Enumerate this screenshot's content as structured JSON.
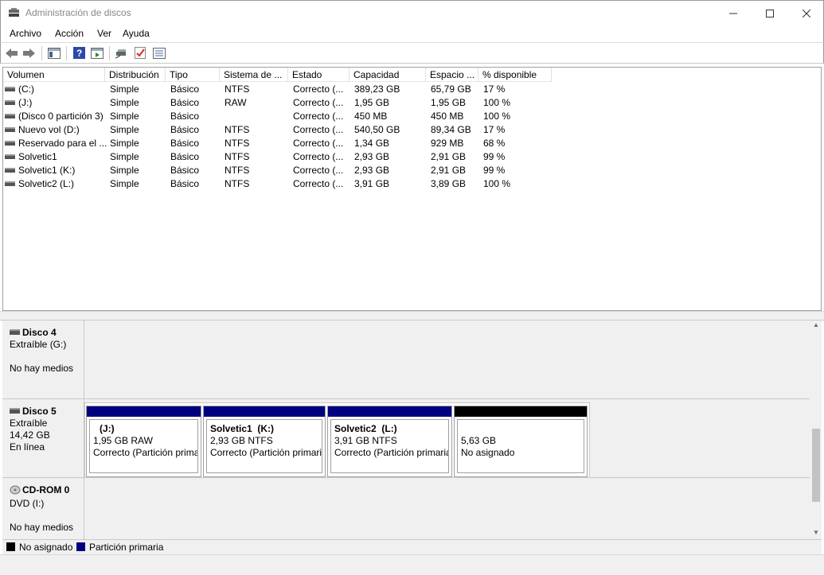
{
  "window": {
    "title": "Administración de discos"
  },
  "menu": [
    "Archivo",
    "Acción",
    "Ver",
    "Ayuda"
  ],
  "columns": [
    "Volumen",
    "Distribución",
    "Tipo",
    "Sistema de ...",
    "Estado",
    "Capacidad",
    "Espacio ...",
    "% disponible"
  ],
  "volumes": [
    {
      "name": "(C:)",
      "layout": "Simple",
      "type": "Básico",
      "fs": "NTFS",
      "status": "Correcto (...",
      "capacity": "389,23 GB",
      "free": "65,79 GB",
      "pct": "17 %"
    },
    {
      "name": "(J:)",
      "layout": "Simple",
      "type": "Básico",
      "fs": "RAW",
      "status": "Correcto (...",
      "capacity": "1,95 GB",
      "free": "1,95 GB",
      "pct": "100 %"
    },
    {
      "name": "(Disco 0 partición 3)",
      "layout": "Simple",
      "type": "Básico",
      "fs": "",
      "status": "Correcto (...",
      "capacity": "450 MB",
      "free": "450 MB",
      "pct": "100 %"
    },
    {
      "name": "Nuevo vol (D:)",
      "layout": "Simple",
      "type": "Básico",
      "fs": "NTFS",
      "status": "Correcto (...",
      "capacity": "540,50 GB",
      "free": "89,34 GB",
      "pct": "17 %"
    },
    {
      "name": "Reservado para el ...",
      "layout": "Simple",
      "type": "Básico",
      "fs": "NTFS",
      "status": "Correcto (...",
      "capacity": "1,34 GB",
      "free": "929 MB",
      "pct": "68 %"
    },
    {
      "name": "Solvetic1",
      "layout": "Simple",
      "type": "Básico",
      "fs": "NTFS",
      "status": "Correcto (...",
      "capacity": "2,93 GB",
      "free": "2,91 GB",
      "pct": "99 %"
    },
    {
      "name": "Solvetic1 (K:)",
      "layout": "Simple",
      "type": "Básico",
      "fs": "NTFS",
      "status": "Correcto (...",
      "capacity": "2,93 GB",
      "free": "2,91 GB",
      "pct": "99 %"
    },
    {
      "name": "Solvetic2 (L:)",
      "layout": "Simple",
      "type": "Básico",
      "fs": "NTFS",
      "status": "Correcto (...",
      "capacity": "3,91 GB",
      "free": "3,89 GB",
      "pct": "100 %"
    }
  ],
  "disks": [
    {
      "name": "Disco 4",
      "line2": "Extraíble (G:)",
      "line3": "",
      "line4": "No hay medios"
    },
    {
      "name": "Disco 5",
      "line2": "Extraíble",
      "line3": "14,42 GB",
      "line4": "En línea"
    },
    {
      "name": "CD-ROM 0",
      "line2": "DVD (I:)",
      "line3": "",
      "line4": "No hay medios"
    }
  ],
  "partitions": [
    {
      "name": "(J:)",
      "size": "1,95 GB RAW",
      "status": "Correcto (Partición primaria)"
    },
    {
      "name": "Solvetic1  (K:)",
      "size": "2,93 GB NTFS",
      "status": "Correcto (Partición primaria)"
    },
    {
      "name": "Solvetic2  (L:)",
      "size": "3,91 GB NTFS",
      "status": "Correcto (Partición primaria)"
    },
    {
      "name": "",
      "size": "5,63 GB",
      "status": "No asignado"
    }
  ],
  "legend": {
    "unallocated": "No asignado",
    "primary": "Partición primaria"
  },
  "colors": {
    "primary": "#000080",
    "unallocated": "#000000"
  }
}
